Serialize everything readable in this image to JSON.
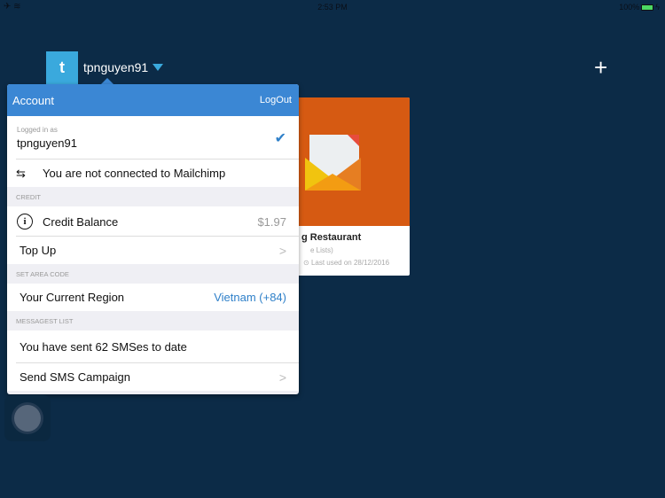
{
  "status_bar": {
    "time": "2:53 PM",
    "battery": "100%",
    "icons": [
      "airplane-icon",
      "wifi-icon",
      "battery-icon",
      "charging-icon"
    ]
  },
  "user": {
    "initial": "t",
    "username": "tpnguyen91"
  },
  "add_label": "+",
  "card": {
    "title": "g Restaurant",
    "subtitle": "e Lists)",
    "last_used": "Last used on 28/12/2016",
    "color": "#d65a12"
  },
  "popover": {
    "title": "Account",
    "logout": "LogOut",
    "logged_in_label": "Logged in as",
    "logged_in_user": "tpnguyen91",
    "mailchimp": "You are not connected to Mailchimp",
    "sections": {
      "credit": "CREDIT",
      "area": "SET AREA CODE",
      "messages": "MESSAGEST LIST"
    },
    "credit_balance_label": "Credit Balance",
    "credit_balance_value": "$1.97",
    "top_up": "Top Up",
    "region_label": "Your Current Region",
    "region_value": "Vietnam (+84)",
    "sent": "You have sent 62 SMSes to date",
    "send_campaign": "Send SMS Campaign"
  },
  "colors": {
    "background": "#0c2b47",
    "header": "#3b87d4",
    "accent": "#3aa9dd",
    "link": "#2f80c9"
  }
}
